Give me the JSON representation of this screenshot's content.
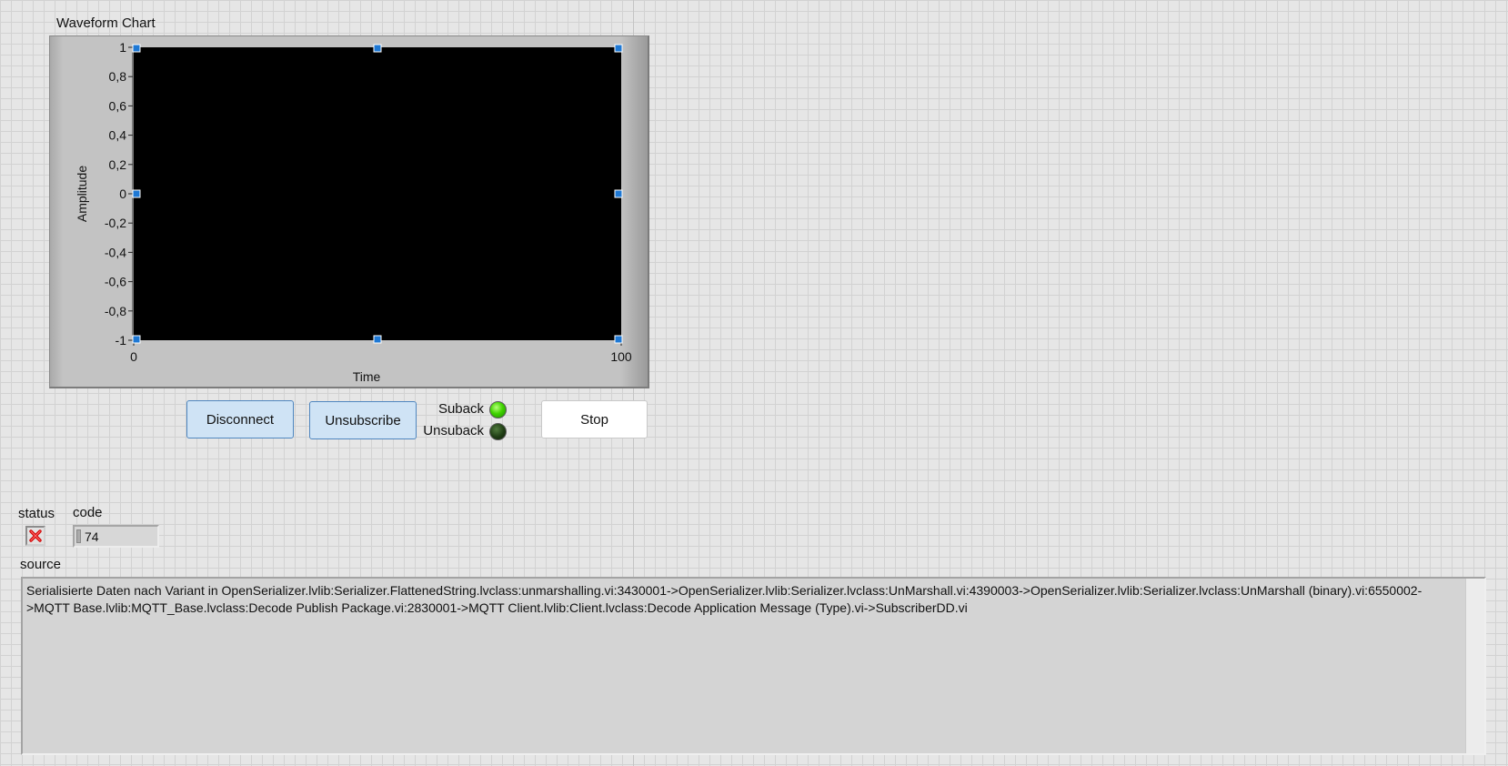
{
  "waveform_chart": {
    "label": "Waveform Chart",
    "chart_data": {
      "type": "line",
      "title": "",
      "xlabel": "Time",
      "ylabel": "Amplitude",
      "xlim": [
        0,
        100
      ],
      "ylim": [
        -1,
        1
      ],
      "x_ticks": [
        "0",
        "100"
      ],
      "y_ticks": [
        "1",
        "0,8",
        "0,6",
        "0,4",
        "0,2",
        "0",
        "-0,2",
        "-0,4",
        "-0,6",
        "-0,8",
        "-1"
      ],
      "series": [],
      "background_color": "#000000"
    }
  },
  "buttons": {
    "disconnect": "Disconnect",
    "unsubscribe": "Unsubscribe",
    "stop": "Stop"
  },
  "indicators": {
    "suback": {
      "label": "Suback",
      "state": "on",
      "color": "#41d400"
    },
    "unsuback": {
      "label": "Unsuback",
      "state": "off",
      "color": "#1f3d14"
    }
  },
  "error_cluster": {
    "status_label": "status",
    "status_icon": "x-mark-icon",
    "code_label": "code",
    "code_radix": "d",
    "code_value": "74",
    "source_label": "source",
    "source_text": "Serialisierte Daten nach Variant in OpenSerializer.lvlib:Serializer.FlattenedString.lvclass:unmarshalling.vi:3430001->OpenSerializer.lvlib:Serializer.lvclass:UnMarshall.vi:4390003->OpenSerializer.lvlib:Serializer.lvclass:UnMarshall (binary).vi:6550002->MQTT Base.lvlib:MQTT_Base.lvclass:Decode Publish Package.vi:2830001->MQTT Client.lvlib:Client.lvclass:Decode Application Message (Type).vi->SubscriberDD.vi"
  }
}
